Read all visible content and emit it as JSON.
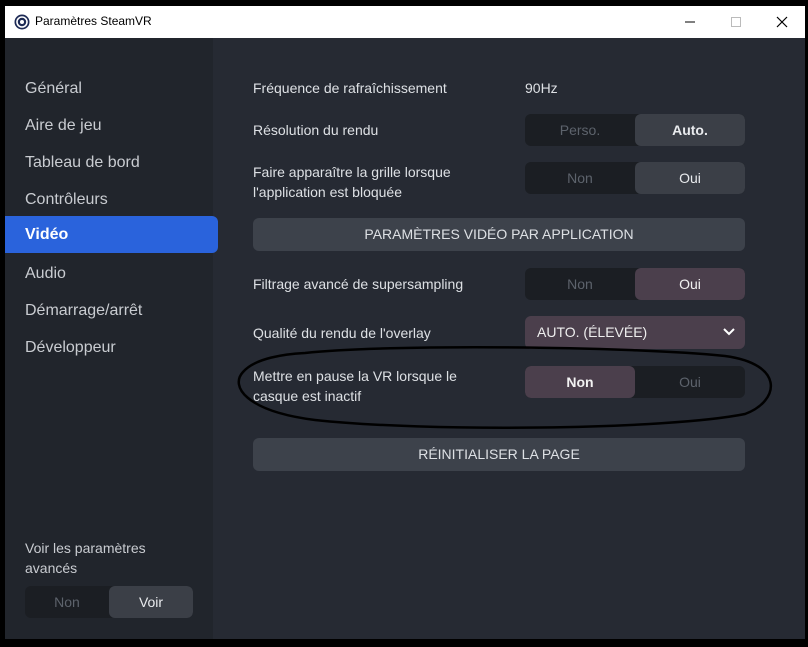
{
  "window": {
    "title": "Paramètres SteamVR"
  },
  "sidebar": {
    "items": [
      {
        "label": "Général",
        "active": false
      },
      {
        "label": "Aire de jeu",
        "active": false
      },
      {
        "label": "Tableau de bord",
        "active": false
      },
      {
        "label": "Contrôleurs",
        "active": false
      },
      {
        "label": "Vidéo",
        "active": true
      },
      {
        "label": "Audio",
        "active": false
      },
      {
        "label": "Démarrage/arrêt",
        "active": false
      },
      {
        "label": "Développeur",
        "active": false
      }
    ],
    "advanced": {
      "label": "Voir les paramètres avancés",
      "off": "Non",
      "on": "Voir",
      "selected": "Voir"
    }
  },
  "main": {
    "refresh_rate": {
      "label": "Fréquence de rafraîchissement",
      "value": "90Hz"
    },
    "render_resolution": {
      "label": "Résolution du rendu",
      "off": "Perso.",
      "on": "Auto.",
      "selected": "Auto."
    },
    "show_grid": {
      "label": "Faire apparaître la grille lorsque l'application est bloquée",
      "off": "Non",
      "on": "Oui",
      "selected": "Oui"
    },
    "per_app_button": "PARAMÈTRES VIDÉO PAR APPLICATION",
    "supersampling": {
      "label": "Filtrage avancé de supersampling",
      "off": "Non",
      "on": "Oui",
      "selected": "Oui"
    },
    "overlay_quality": {
      "label": "Qualité du rendu de l'overlay",
      "value": "AUTO. (ÉLEVÉE)"
    },
    "pause_vr": {
      "label": "Mettre en pause la VR lorsque le casque est inactif",
      "off": "Non",
      "on": "Oui",
      "selected": "Non"
    },
    "reset_button": "RÉINITIALISER LA PAGE"
  },
  "colors": {
    "accent": "#2a63dc",
    "toggle_on": "#4b3f4c",
    "background": "#262a33",
    "sidebar": "#21252c"
  }
}
